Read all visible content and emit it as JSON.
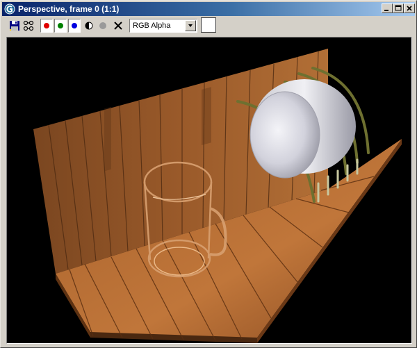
{
  "window": {
    "title": "Perspective, frame 0 (1:1)"
  },
  "toolbar": {
    "tools": [
      {
        "name": "save-icon"
      },
      {
        "name": "clone-icon"
      }
    ],
    "channels": [
      {
        "name": "red-channel",
        "color": "#e00000"
      },
      {
        "name": "green-channel",
        "color": "#008000"
      },
      {
        "name": "blue-channel",
        "color": "#0000e0"
      }
    ],
    "display_dropdown": {
      "value": "RGB Alpha"
    },
    "background_swatch_color": "#ffffff"
  },
  "viewport": {
    "background_color": "#000000",
    "scene": [
      "wooden-wall",
      "wooden-floor",
      "glass-mug",
      "white-bowl",
      "dish-rack-wires"
    ]
  }
}
